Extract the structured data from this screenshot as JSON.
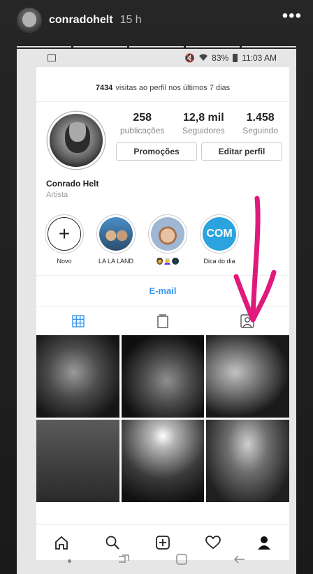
{
  "story": {
    "username": "conradohelt",
    "time": "15 h",
    "more_glyph": "•••"
  },
  "status_bar": {
    "battery": "83%",
    "time": "11:03 AM"
  },
  "profile": {
    "visits_count": "7434",
    "visits_text": "visitas ao perfil nos últimos 7 dias",
    "stats": [
      {
        "value": "258",
        "label": "publicações"
      },
      {
        "value": "12,8 mil",
        "label": "Seguidores"
      },
      {
        "value": "1.458",
        "label": "Seguindo"
      }
    ],
    "promo_button": "Promoções",
    "edit_button": "Editar perfil",
    "name": "Conrado Helt",
    "category": "Artista"
  },
  "highlights": [
    {
      "label": "Novo",
      "icon": "plus-icon"
    },
    {
      "label": "LA LA LAND",
      "icon": "photo"
    },
    {
      "label": "🧔👩‍🦳🌑",
      "icon": "photo"
    },
    {
      "label": "Dica do dia",
      "icon": "photo",
      "thumb_text": "COM"
    }
  ],
  "contact": {
    "email_label": "E-mail"
  },
  "tabs": [
    "grid-icon",
    "igtv-icon",
    "tagged-icon"
  ],
  "bottom_nav": [
    "home-icon",
    "search-icon",
    "add-post-icon",
    "heart-icon",
    "profile-icon"
  ],
  "colors": {
    "accent": "#3897f0",
    "annotation": "#e0197d"
  }
}
